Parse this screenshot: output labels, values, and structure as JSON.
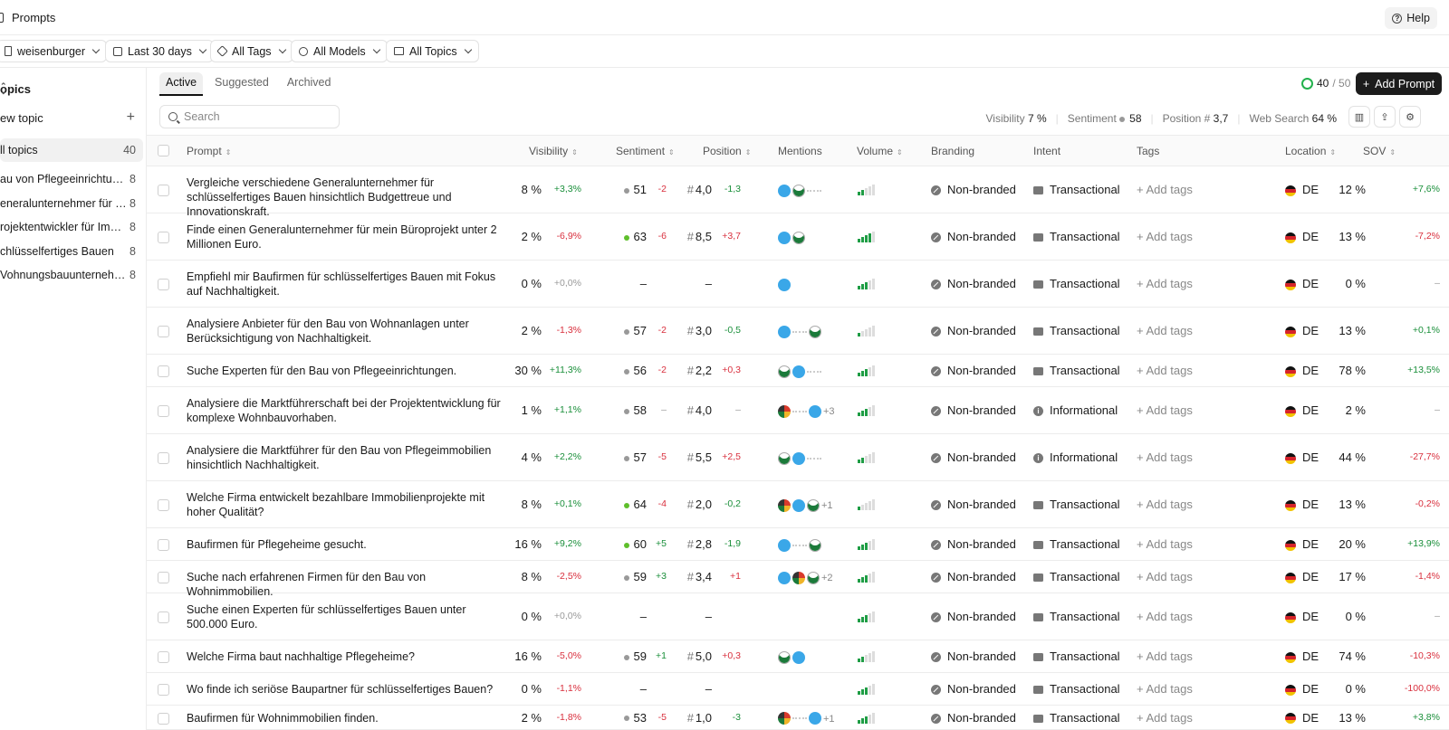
{
  "topbar": {
    "title": "Prompts",
    "help": "Help"
  },
  "filters": {
    "workspace": "weisenburger",
    "range": "Last 30 days",
    "tags": "All Tags",
    "models": "All Models",
    "topics": "All Topics"
  },
  "sidebar": {
    "title": "opics",
    "new_topic": "ew topic",
    "items": [
      {
        "label": "ll topics",
        "count": "40"
      },
      {
        "label": "au von Pflegeeinrichtung…",
        "count": "8"
      },
      {
        "label": "eneralunternehmer für Ge…",
        "count": "8"
      },
      {
        "label": "rojektentwickler für Immo…",
        "count": "8"
      },
      {
        "label": "chlüsselfertiges Bauen",
        "count": "8"
      },
      {
        "label": "Vohnungsbauunternehmen",
        "count": "8"
      }
    ]
  },
  "tabs": [
    "Active",
    "Suggested",
    "Archived"
  ],
  "counter": {
    "used": "40",
    "total": "/ 50"
  },
  "add_prompt": "Add Prompt",
  "search": {
    "placeholder": "Search"
  },
  "stats": {
    "visibility_label": "Visibility",
    "visibility": "7 %",
    "sentiment_label": "Sentiment",
    "sentiment": "58",
    "position_label": "Position #",
    "position": "3,7",
    "web_label": "Web Search",
    "web": "64 %"
  },
  "columns": {
    "prompt": "Prompt",
    "visibility": "Visibility",
    "sentiment": "Sentiment",
    "position": "Position",
    "mentions": "Mentions",
    "volume": "Volume",
    "branding": "Branding",
    "intent": "Intent",
    "tags": "Tags",
    "location": "Location",
    "sov": "SOV"
  },
  "add_tags": "Add tags",
  "rows": [
    {
      "prompt": "Vergleiche verschiedene Generalunternehmer für schlüsselfertiges Bauen hinsichtlich Budgettreue und Innovationskraft.",
      "vis": "8 %",
      "vis_d": "+3,3%",
      "sent": "51",
      "sent_d": "-2",
      "sent_dot": "grey",
      "pos": "4,0",
      "pos_d": "-1,3",
      "pos_d_class": "pos",
      "mentions": [
        "b",
        "w",
        "dash"
      ],
      "more": "",
      "vol": 2,
      "brand": "Non-branded",
      "intent": "Transactional",
      "intent_type": "tr",
      "loc": "DE",
      "sov": "12 %",
      "sov_d": "+7,6%"
    },
    {
      "prompt": "Finde einen Generalunternehmer für mein Büroprojekt unter 2 Millionen Euro.",
      "vis": "2 %",
      "vis_d": "-6,9%",
      "sent": "63",
      "sent_d": "-6",
      "sent_dot": "green",
      "pos": "8,5",
      "pos_d": "+3,7",
      "pos_d_class": "neg",
      "mentions": [
        "b",
        "w"
      ],
      "more": "",
      "vol": 4,
      "brand": "Non-branded",
      "intent": "Transactional",
      "intent_type": "tr",
      "loc": "DE",
      "sov": "13 %",
      "sov_d": "-7,2%"
    },
    {
      "prompt": "Empfiehl mir Baufirmen für schlüsselfertiges Bauen mit Fokus auf Nachhaltigkeit.",
      "vis": "0 %",
      "vis_d": "+0,0%",
      "sent": "–",
      "sent_d": "",
      "sent_dot": "none",
      "pos": "–",
      "pos_d": "",
      "pos_d_class": "neu",
      "mentions": [
        "b"
      ],
      "more": "",
      "vol": 3,
      "brand": "Non-branded",
      "intent": "Transactional",
      "intent_type": "tr",
      "loc": "DE",
      "sov": "0 %",
      "sov_d": "–"
    },
    {
      "prompt": "Analysiere Anbieter für den Bau von Wohnanlagen unter Berücksichtigung von Nachhaltigkeit.",
      "vis": "2 %",
      "vis_d": "-1,3%",
      "sent": "57",
      "sent_d": "-2",
      "sent_dot": "grey",
      "pos": "3,0",
      "pos_d": "-0,5",
      "pos_d_class": "pos",
      "mentions": [
        "b",
        "dash",
        "w"
      ],
      "more": "",
      "vol": 1,
      "brand": "Non-branded",
      "intent": "Transactional",
      "intent_type": "tr",
      "loc": "DE",
      "sov": "13 %",
      "sov_d": "+0,1%"
    },
    {
      "prompt": "Suche Experten für den Bau von Pflegeeinrichtungen.",
      "vis": "30 %",
      "vis_d": "+11,3%",
      "sent": "56",
      "sent_d": "-2",
      "sent_dot": "grey",
      "pos": "2,2",
      "pos_d": "+0,3",
      "pos_d_class": "neg",
      "mentions": [
        "w",
        "b",
        "dash"
      ],
      "more": "",
      "vol": 3,
      "brand": "Non-branded",
      "intent": "Transactional",
      "intent_type": "tr",
      "loc": "DE",
      "sov": "78 %",
      "sov_d": "+13,5%"
    },
    {
      "prompt": "Analysiere die Marktführerschaft bei der Projektentwicklung für komplexe Wohnbauvorhaben.",
      "vis": "1 %",
      "vis_d": "+1,1%",
      "sent": "58",
      "sent_d": "–",
      "sent_dot": "grey",
      "pos": "4,0",
      "pos_d": "–",
      "pos_d_class": "neu",
      "mentions": [
        "c",
        "dash",
        "b"
      ],
      "more": "+3",
      "vol": 3,
      "brand": "Non-branded",
      "intent": "Informational",
      "intent_type": "inf",
      "loc": "DE",
      "sov": "2 %",
      "sov_d": "–"
    },
    {
      "prompt": "Analysiere die Marktführer für den Bau von Pflegeimmobilien hinsichtlich Nachhaltigkeit.",
      "vis": "4 %",
      "vis_d": "+2,2%",
      "sent": "57",
      "sent_d": "-5",
      "sent_dot": "grey",
      "pos": "5,5",
      "pos_d": "+2,5",
      "pos_d_class": "neg",
      "mentions": [
        "w",
        "b",
        "dash"
      ],
      "more": "",
      "vol": 2,
      "brand": "Non-branded",
      "intent": "Informational",
      "intent_type": "inf",
      "loc": "DE",
      "sov": "44 %",
      "sov_d": "-27,7%"
    },
    {
      "prompt": "Welche Firma entwickelt bezahlbare Immobilienprojekte mit hoher Qualität?",
      "vis": "8 %",
      "vis_d": "+0,1%",
      "sent": "64",
      "sent_d": "-4",
      "sent_dot": "green",
      "pos": "2,0",
      "pos_d": "-0,2",
      "pos_d_class": "pos",
      "mentions": [
        "c",
        "b",
        "w"
      ],
      "more": "+1",
      "vol": 1,
      "brand": "Non-branded",
      "intent": "Transactional",
      "intent_type": "tr",
      "loc": "DE",
      "sov": "13 %",
      "sov_d": "-0,2%"
    },
    {
      "prompt": "Baufirmen für Pflegeheime gesucht.",
      "vis": "16 %",
      "vis_d": "+9,2%",
      "sent": "60",
      "sent_d": "+5",
      "sent_dot": "green",
      "pos": "2,8",
      "pos_d": "-1,9",
      "pos_d_class": "pos",
      "mentions": [
        "b",
        "dash",
        "w"
      ],
      "more": "",
      "vol": 3,
      "brand": "Non-branded",
      "intent": "Transactional",
      "intent_type": "tr",
      "loc": "DE",
      "sov": "20 %",
      "sov_d": "+13,9%"
    },
    {
      "prompt": "Suche nach erfahrenen Firmen für den Bau von Wohnimmobilien.",
      "vis": "8 %",
      "vis_d": "-2,5%",
      "sent": "59",
      "sent_d": "+3",
      "sent_dot": "grey",
      "pos": "3,4",
      "pos_d": "+1",
      "pos_d_class": "neg",
      "mentions": [
        "b",
        "c",
        "w"
      ],
      "more": "+2",
      "vol": 3,
      "brand": "Non-branded",
      "intent": "Transactional",
      "intent_type": "tr",
      "loc": "DE",
      "sov": "17 %",
      "sov_d": "-1,4%"
    },
    {
      "prompt": "Suche einen Experten für schlüsselfertiges Bauen unter 500.000 Euro.",
      "vis": "0 %",
      "vis_d": "+0,0%",
      "sent": "–",
      "sent_d": "",
      "sent_dot": "none",
      "pos": "–",
      "pos_d": "",
      "pos_d_class": "neu",
      "mentions": [],
      "more": "",
      "vol": 3,
      "brand": "Non-branded",
      "intent": "Transactional",
      "intent_type": "tr",
      "loc": "DE",
      "sov": "0 %",
      "sov_d": "–"
    },
    {
      "prompt": "Welche Firma baut nachhaltige Pflegeheime?",
      "vis": "16 %",
      "vis_d": "-5,0%",
      "sent": "59",
      "sent_d": "+1",
      "sent_dot": "grey",
      "pos": "5,0",
      "pos_d": "+0,3",
      "pos_d_class": "neg",
      "mentions": [
        "w",
        "b"
      ],
      "more": "",
      "vol": 2,
      "brand": "Non-branded",
      "intent": "Transactional",
      "intent_type": "tr",
      "loc": "DE",
      "sov": "74 %",
      "sov_d": "-10,3%"
    },
    {
      "prompt": "Wo finde ich seriöse Baupartner für schlüsselfertiges Bauen?",
      "vis": "0 %",
      "vis_d": "-1,1%",
      "sent": "–",
      "sent_d": "",
      "sent_dot": "none",
      "pos": "–",
      "pos_d": "",
      "pos_d_class": "neu",
      "mentions": [],
      "more": "",
      "vol": 3,
      "brand": "Non-branded",
      "intent": "Transactional",
      "intent_type": "tr",
      "loc": "DE",
      "sov": "0 %",
      "sov_d": "-100,0%"
    },
    {
      "prompt": "Baufirmen für Wohnimmobilien finden.",
      "vis": "2 %",
      "vis_d": "-1,8%",
      "sent": "53",
      "sent_d": "-5",
      "sent_dot": "grey",
      "pos": "1,0",
      "pos_d": "-3",
      "pos_d_class": "pos",
      "mentions": [
        "c",
        "dash",
        "b"
      ],
      "more": "+1",
      "vol": 3,
      "brand": "Non-branded",
      "intent": "Transactional",
      "intent_type": "tr",
      "loc": "DE",
      "sov": "13 %",
      "sov_d": "+3,8%"
    }
  ]
}
